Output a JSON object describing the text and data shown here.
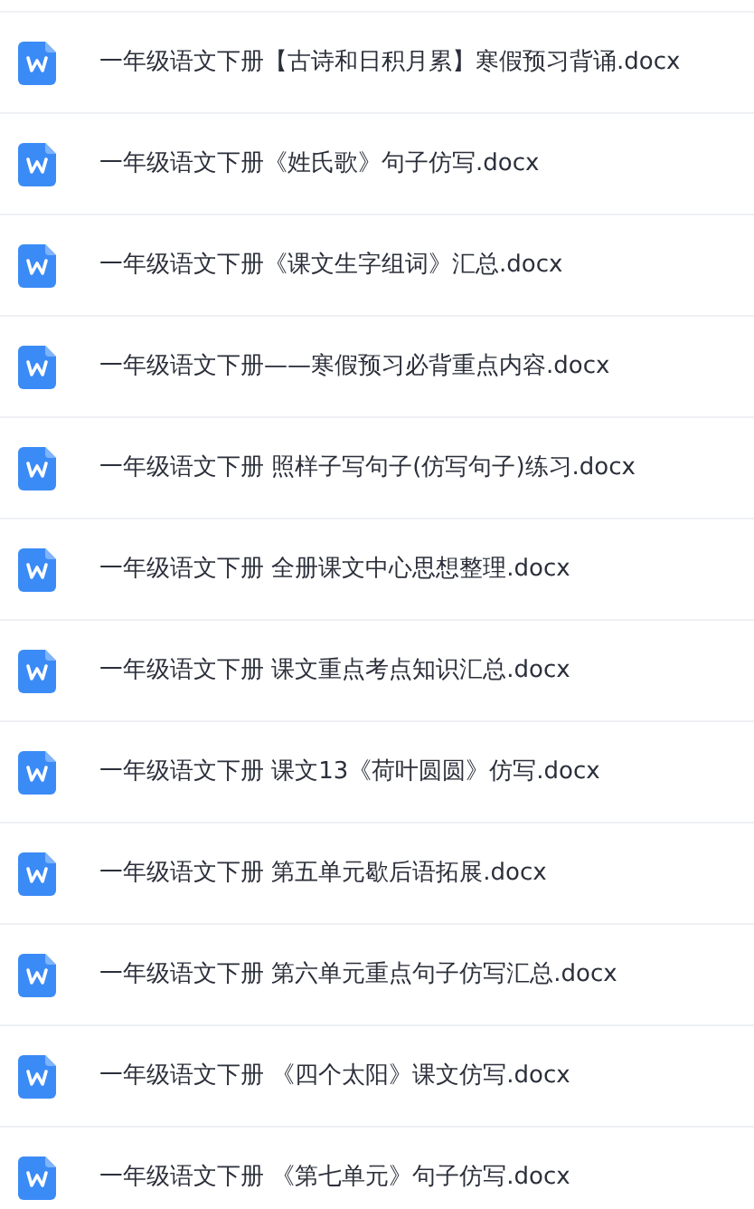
{
  "files": [
    {
      "name": "一年级语文下册【古诗和日积月累】寒假预习背诵.docx"
    },
    {
      "name": "一年级语文下册《姓氏歌》句子仿写.docx"
    },
    {
      "name": "一年级语文下册《课文生字组词》汇总.docx"
    },
    {
      "name": "一年级语文下册——寒假预习必背重点内容.docx"
    },
    {
      "name": "一年级语文下册 照样子写句子(仿写句子)练习.docx"
    },
    {
      "name": "一年级语文下册 全册课文中心思想整理.docx"
    },
    {
      "name": "一年级语文下册 课文重点考点知识汇总.docx"
    },
    {
      "name": "一年级语文下册 课文13《荷叶圆圆》仿写.docx"
    },
    {
      "name": "一年级语文下册 第五单元歇后语拓展.docx"
    },
    {
      "name": "一年级语文下册 第六单元重点句子仿写汇总.docx"
    },
    {
      "name": "一年级语文下册 《四个太阳》课文仿写.docx"
    },
    {
      "name": "一年级语文下册 《第七单元》句子仿写.docx"
    }
  ]
}
